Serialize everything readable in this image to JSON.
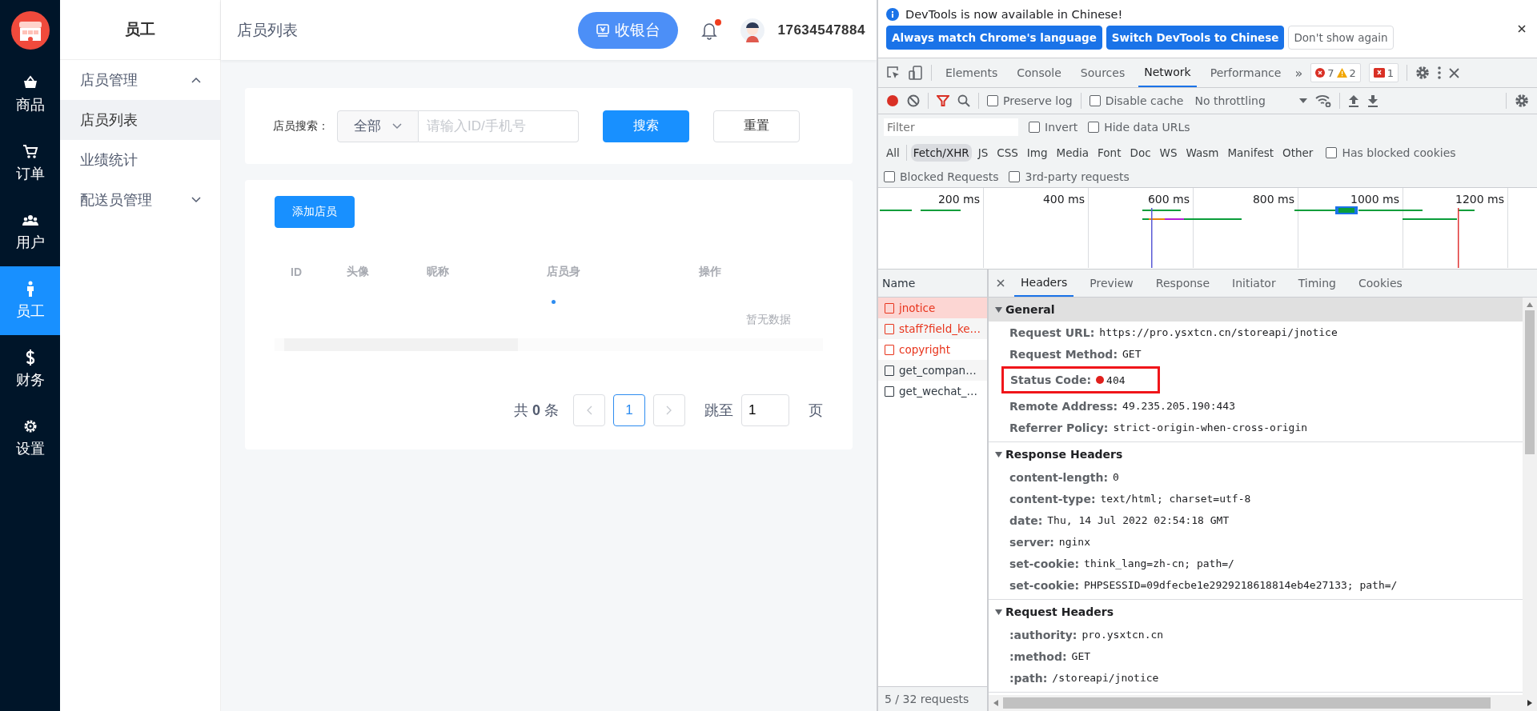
{
  "app": {
    "nav": [
      {
        "kind": "basket",
        "label": "商品",
        "selected": false
      },
      {
        "kind": "cart",
        "label": "订单",
        "selected": false
      },
      {
        "kind": "users",
        "label": "用户",
        "selected": false
      },
      {
        "kind": "person",
        "label": "员工",
        "selected": true
      },
      {
        "kind": "dollar",
        "label": "财务",
        "selected": false
      },
      {
        "kind": "gear",
        "label": "设置",
        "selected": false
      }
    ],
    "sidebar": {
      "title": "员工",
      "items": [
        {
          "label": "店员管理",
          "expanded": true,
          "children": [
            {
              "label": "店员列表",
              "selected": true
            },
            {
              "label": "业绩统计",
              "selected": false
            }
          ]
        },
        {
          "label": "配送员管理",
          "expanded": false
        }
      ]
    },
    "header": {
      "breadcrumb": "店员列表",
      "cashier_button": "收银台",
      "has_unread": true,
      "user": "17634547884"
    },
    "search": {
      "label": "店员搜索：",
      "scope": "全部",
      "placeholder": "请输入ID/手机号",
      "search_button": "搜索",
      "reset_button": "重置"
    },
    "add_button": "添加店员",
    "table": {
      "columns": [
        "ID",
        "头像",
        "昵称",
        "店员身",
        "操作"
      ],
      "empty_text": "暂无数据",
      "loading": true
    },
    "pagination": {
      "total": "共 **0** 条",
      "pages": [
        {
          "label": "1",
          "selected": true
        }
      ],
      "jump_label": "跳至",
      "jump_value": "1",
      "page_suffix": "页"
    }
  },
  "devtools": {
    "notice": {
      "text": "DevTools is now available in Chinese!",
      "buttons": [
        {
          "label": "Always match Chrome's language",
          "primary": true
        },
        {
          "label": "Switch DevTools to Chinese",
          "primary": true
        },
        {
          "label": "Don't show again",
          "primary": false
        }
      ]
    },
    "tabs": [
      {
        "label": "Elements",
        "selected": false
      },
      {
        "label": "Console",
        "selected": false
      },
      {
        "label": "Sources",
        "selected": false
      },
      {
        "label": "Network",
        "selected": true
      },
      {
        "label": "Performance",
        "selected": false
      }
    ],
    "more_tabs": "»",
    "errors": "7",
    "warnings": "2",
    "issues": "1",
    "toolbar": {
      "recording": true,
      "preserve_log": {
        "label": "Preserve log",
        "checked": false
      },
      "disable_cache": {
        "label": "Disable cache",
        "checked": false
      },
      "throttling": "No throttling"
    },
    "filter": {
      "placeholder": "Filter",
      "invert": {
        "label": "Invert",
        "checked": false
      },
      "hide_data_urls": {
        "label": "Hide data URLs",
        "checked": false
      },
      "types": [
        {
          "label": "All",
          "selected": false
        },
        {
          "label": "Fetch/XHR",
          "selected": true
        },
        {
          "label": "JS",
          "selected": false
        },
        {
          "label": "CSS",
          "selected": false
        },
        {
          "label": "Img",
          "selected": false
        },
        {
          "label": "Media",
          "selected": false
        },
        {
          "label": "Font",
          "selected": false
        },
        {
          "label": "Doc",
          "selected": false
        },
        {
          "label": "WS",
          "selected": false
        },
        {
          "label": "Wasm",
          "selected": false
        },
        {
          "label": "Manifest",
          "selected": false
        },
        {
          "label": "Other",
          "selected": false
        }
      ],
      "has_blocked_cookies": {
        "label": "Has blocked cookies",
        "checked": false
      },
      "blocked_requests": {
        "label": "Blocked Requests",
        "checked": false
      },
      "third_party_requests": {
        "label": "3rd-party requests",
        "checked": false
      }
    },
    "overview_ticks": [
      "200 ms",
      "400 ms",
      "600 ms",
      "800 ms",
      "1000 ms",
      "1200 ms"
    ],
    "name_header": "Name",
    "requests": [
      {
        "name": "jnotice",
        "failed": true,
        "selected": true
      },
      {
        "name": "staff?field_ke…",
        "failed": true,
        "selected": false
      },
      {
        "name": "copyright",
        "failed": true,
        "selected": false
      },
      {
        "name": "get_compan…",
        "failed": false,
        "selected": false
      },
      {
        "name": "get_wechat_…",
        "failed": false,
        "selected": false
      }
    ],
    "summary": "5 / 32 requests",
    "detail_tabs": [
      {
        "label": "Headers",
        "selected": true
      },
      {
        "label": "Preview",
        "selected": false
      },
      {
        "label": "Response",
        "selected": false
      },
      {
        "label": "Initiator",
        "selected": false
      },
      {
        "label": "Timing",
        "selected": false
      },
      {
        "label": "Cookies",
        "selected": false
      }
    ],
    "sections": [
      {
        "title": "General",
        "expanded": true,
        "rows": [
          {
            "key": "Request URL:",
            "value": "https://pro.ysxtcn.cn/storeapi/jnotice",
            "highlighted": false
          },
          {
            "key": "Request Method:",
            "value": "GET",
            "highlighted": false
          },
          {
            "key": "Status Code:",
            "value": "404",
            "color": "#e0201c",
            "highlighted": true
          },
          {
            "key": "Remote Address:",
            "value": "49.235.205.190:443",
            "highlighted": false
          },
          {
            "key": "Referrer Policy:",
            "value": "strict-origin-when-cross-origin",
            "highlighted": false
          }
        ]
      },
      {
        "title": "Response Headers",
        "expanded": true,
        "rows": [
          {
            "key": "content-length:",
            "value": "0",
            "highlighted": false
          },
          {
            "key": "content-type:",
            "value": "text/html; charset=utf-8",
            "highlighted": false
          },
          {
            "key": "date:",
            "value": "Thu, 14 Jul 2022 02:54:18 GMT",
            "highlighted": false
          },
          {
            "key": "server:",
            "value": "nginx",
            "highlighted": false
          },
          {
            "key": "set-cookie:",
            "value": "think_lang=zh-cn; path=/",
            "highlighted": false
          },
          {
            "key": "set-cookie:",
            "value": "PHPSESSID=09dfecbe1e2929218618814eb4e27133; path=/",
            "highlighted": false
          }
        ]
      },
      {
        "title": "Request Headers",
        "expanded": true,
        "rows": [
          {
            "key": ":authority:",
            "value": "pro.ysxtcn.cn",
            "highlighted": false
          },
          {
            "key": ":method:",
            "value": "GET",
            "highlighted": false
          },
          {
            "key": ":path:",
            "value": "/storeapi/jnotice",
            "highlighted": false
          }
        ]
      }
    ]
  }
}
